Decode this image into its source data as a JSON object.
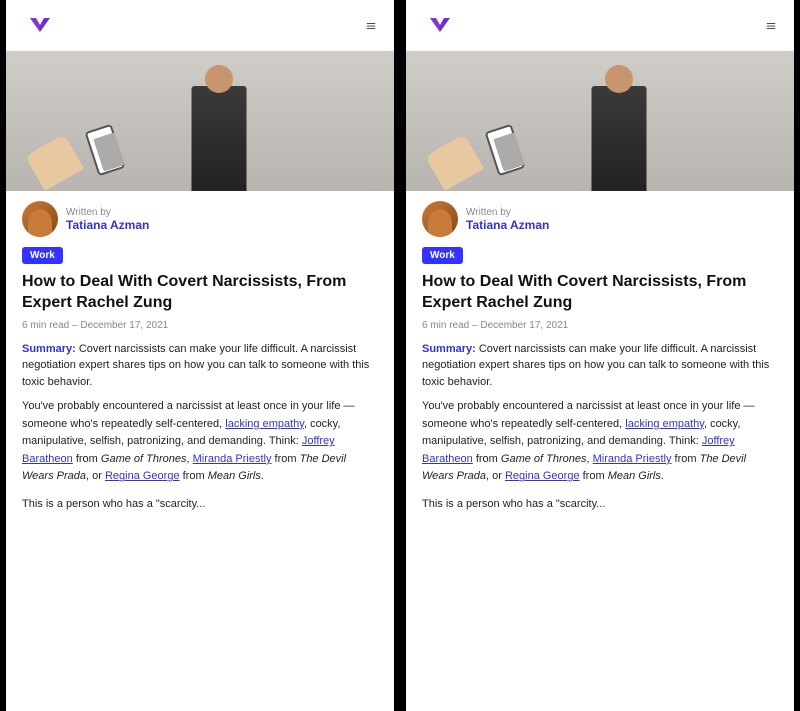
{
  "panels": [
    {
      "id": "panel-left",
      "header": {
        "logo_alt": "Logo",
        "menu_icon": "≡"
      },
      "author": {
        "written_by": "Written by",
        "name": "Tatiana Azman"
      },
      "tag": "Work",
      "title": "How to Deal With Covert Narcissists, From Expert Rachel Zung",
      "meta": "6 min read  –  December 17, 2021",
      "summary_label": "Summary:",
      "summary_text": " Covert narcissists can make your life difficult. A narcissist negotiation expert shares tips on how you can talk to someone with this toxic behavior.",
      "body1": "You've probably encountered a narcissist at least once in your life — someone who's repeatedly self-centered, ",
      "link1": "lacking empathy",
      "body2": ", cocky, manipulative, selfish, patronizing, and demanding. Think: ",
      "link2": "Joffrey Baratheon",
      "body3": " from ",
      "italic1": "Game of Thrones",
      "body4": ", ",
      "link3": "Miranda Priestly",
      "body5": " from ",
      "italic2": "The Devil Wears Prada",
      "body6": ", or ",
      "link4": "Regina George",
      "body7": " from ",
      "italic3": "Mean Girls",
      "body8": ".",
      "body_end": "This is a person who has a \"scarcity..."
    },
    {
      "id": "panel-right",
      "header": {
        "logo_alt": "Logo",
        "menu_icon": "≡"
      },
      "author": {
        "written_by": "Written by",
        "name": "Tatiana Azman"
      },
      "tag": "Work",
      "title": "How to Deal With Covert Narcissists, From Expert Rachel Zung",
      "meta": "6 min read  –  December 17, 2021",
      "summary_label": "Summary:",
      "summary_text": " Covert narcissists can make your life difficult. A narcissist negotiation expert shares tips on how you can talk to someone with this toxic behavior.",
      "body1": "You've probably encountered a narcissist at least once in your life — someone who's repeatedly self-centered, ",
      "link1": "lacking empathy",
      "body2": ", cocky, manipulative, selfish, patronizing, and demanding. Think: ",
      "link2": "Joffrey Baratheon",
      "body3": " from ",
      "italic1": "Game of Thrones",
      "body4": ", ",
      "link3": "Miranda Priestly",
      "body5": " from ",
      "italic2": "The Devil Wears Prada",
      "body6": ", or ",
      "link4": "Regina George",
      "body7": " from ",
      "italic3": "Mean Girls",
      "body8": ".",
      "body_end": "This is a person who has a \"scarcity..."
    }
  ],
  "colors": {
    "accent_blue": "#3333cc",
    "tag_blue": "#3333ff",
    "text_dark": "#111111",
    "text_light": "#888888",
    "background": "#ffffff",
    "outer": "#000000"
  }
}
